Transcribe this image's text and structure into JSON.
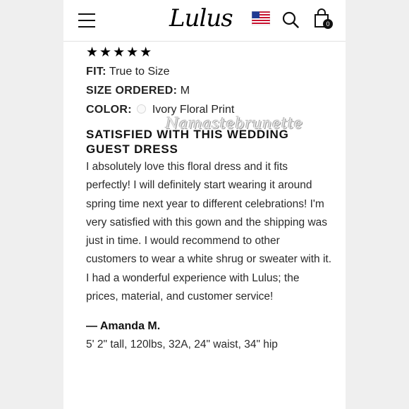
{
  "header": {
    "logo": "Lulus",
    "cart_count": "0"
  },
  "review": {
    "rating": "★★★★★",
    "fit_label": "FIT:",
    "fit_value": "True to Size",
    "size_label": "SIZE ORDERED:",
    "size_value": "M",
    "color_label": "COLOR:",
    "color_value": "Ivory Floral Print",
    "title": "SATISFIED WITH THIS WEDDING GUEST DRESS",
    "body": "I absolutely love this floral dress and it fits perfectly! I will definitely start wearing it around spring time next year to different celebrations! I'm very satisfied with this gown and the shipping was just in time. I would recommend to other customers to wear a white shrug or sweater with it. I had a wonderful experience with Lulus; the prices, material, and customer service!",
    "author": "— Amanda M.",
    "stats": "5' 2\" tall, 120lbs, 32A, 24\" waist, 34\" hip"
  },
  "watermark": "Namastebrunette",
  "colors": {
    "page_background": "#efefef",
    "content_background": "#ffffff",
    "text": "#222222",
    "swatch": "#fafafa"
  },
  "icons": [
    "menu-icon",
    "us-flag-icon",
    "search-icon",
    "shopping-bag-icon"
  ]
}
